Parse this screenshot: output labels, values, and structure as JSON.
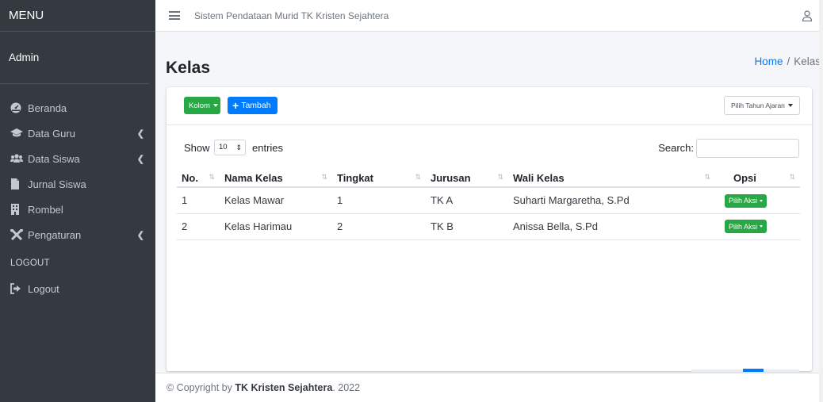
{
  "sidebar": {
    "brand": "MENU",
    "user": "Admin",
    "items": [
      {
        "label": "Beranda",
        "icon": "dashboard-icon",
        "has_children": false
      },
      {
        "label": "Data Guru",
        "icon": "graduation-cap-icon",
        "has_children": true
      },
      {
        "label": "Data Siswa",
        "icon": "users-icon",
        "has_children": true
      },
      {
        "label": "Jurnal Siswa",
        "icon": "file-icon",
        "has_children": false
      },
      {
        "label": "Rombel",
        "icon": "building-icon",
        "has_children": false
      },
      {
        "label": "Pengaturan",
        "icon": "tools-icon",
        "has_children": true
      }
    ],
    "section_header": "LOGOUT",
    "logout_label": "Logout"
  },
  "topbar": {
    "title": "Sistem Pendataan Murid TK Kristen Sejahtera"
  },
  "page": {
    "title": "Kelas",
    "breadcrumb": {
      "home": "Home",
      "separator": "/",
      "current": "Kelas"
    }
  },
  "card": {
    "kolom_label": "Kolom",
    "tambah_label": "Tambah",
    "tahun_select": "Pilih Tahun Ajaran",
    "show_label": "Show",
    "page_length": "10",
    "entries_label": "entries",
    "search_label": "Search:",
    "search_value": ""
  },
  "table": {
    "columns": [
      "No.",
      "Nama Kelas",
      "Tingkat",
      "Jurusan",
      "Wali Kelas",
      "Opsi"
    ],
    "rows": [
      {
        "no": "1",
        "nama": "Kelas Mawar",
        "tingkat": "1",
        "jurusan": "TK A",
        "wali": "Suharti Margaretha, S.Pd",
        "aksi": "Pilih Aksi"
      },
      {
        "no": "2",
        "nama": "Kelas Harimau",
        "tingkat": "2",
        "jurusan": "TK B",
        "wali": "Anissa Bella, S.Pd",
        "aksi": "Pilih Aksi"
      }
    ]
  },
  "footer": {
    "prefix": "© Copyright by",
    "org": "TK Kristen Sejahtera",
    "year": ". 2022"
  },
  "colors": {
    "sidebar_bg": "#343a40",
    "primary": "#007bff",
    "success": "#28a745"
  }
}
